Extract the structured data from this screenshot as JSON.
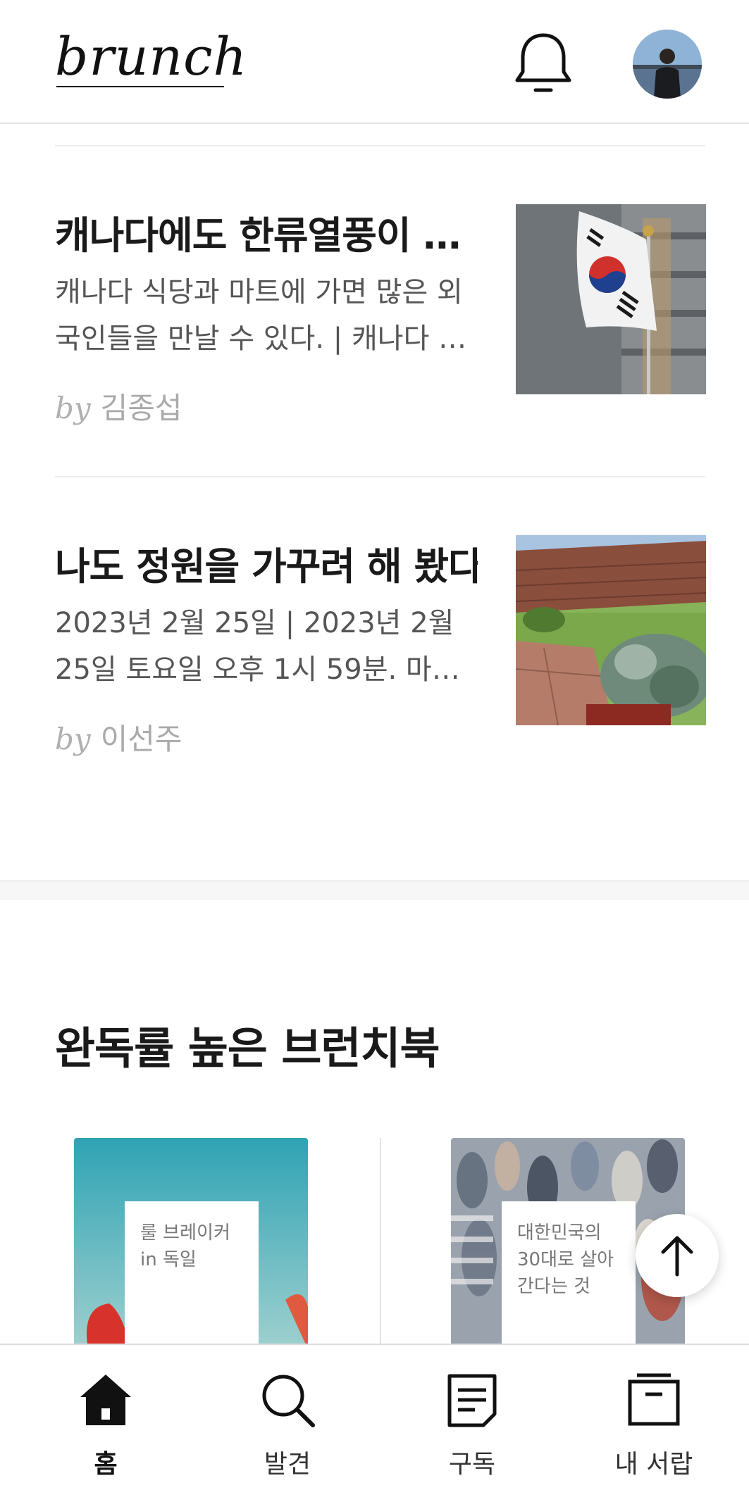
{
  "header": {
    "logo": "brunch",
    "notification_icon": "bell-icon",
    "avatar_icon": "profile-avatar"
  },
  "articles": [
    {
      "title": "캐나다에도 한류열풍이 …",
      "desc_line1": "캐나다 식당과 마트에 가면 많은 외",
      "desc_line2": "국인들을 만날 수 있다. | 캐나다 …",
      "by": "by",
      "author": "김종섭",
      "thumb": "korean-flag-photo"
    },
    {
      "title": "나도 정원을 가꾸려 해 봤다",
      "desc_line1": "2023년 2월 25일 | 2023년 2월",
      "desc_line2": "25일 토요일 오후 1시 59분. 마…",
      "by": "by",
      "author": "이선주",
      "thumb": "garden-photo"
    }
  ],
  "section": {
    "title": "완독률 높은 브런치북"
  },
  "books": [
    {
      "title_line1": "룰 브레이커",
      "title_line2": "in 독일",
      "title_line3": ""
    },
    {
      "title_line1": "대한민국의",
      "title_line2": "30대로 살아",
      "title_line3": "간다는 것"
    }
  ],
  "nav": {
    "items": [
      {
        "label": "홈",
        "icon": "home-icon",
        "active": true
      },
      {
        "label": "발견",
        "icon": "search-icon",
        "active": false
      },
      {
        "label": "구독",
        "icon": "document-icon",
        "active": false
      },
      {
        "label": "내 서랍",
        "icon": "drawer-icon",
        "active": false
      }
    ]
  },
  "colors": {
    "text": "#1a1a1a",
    "muted": "#555555",
    "author": "#aaaaaa",
    "divider": "#ececec"
  }
}
